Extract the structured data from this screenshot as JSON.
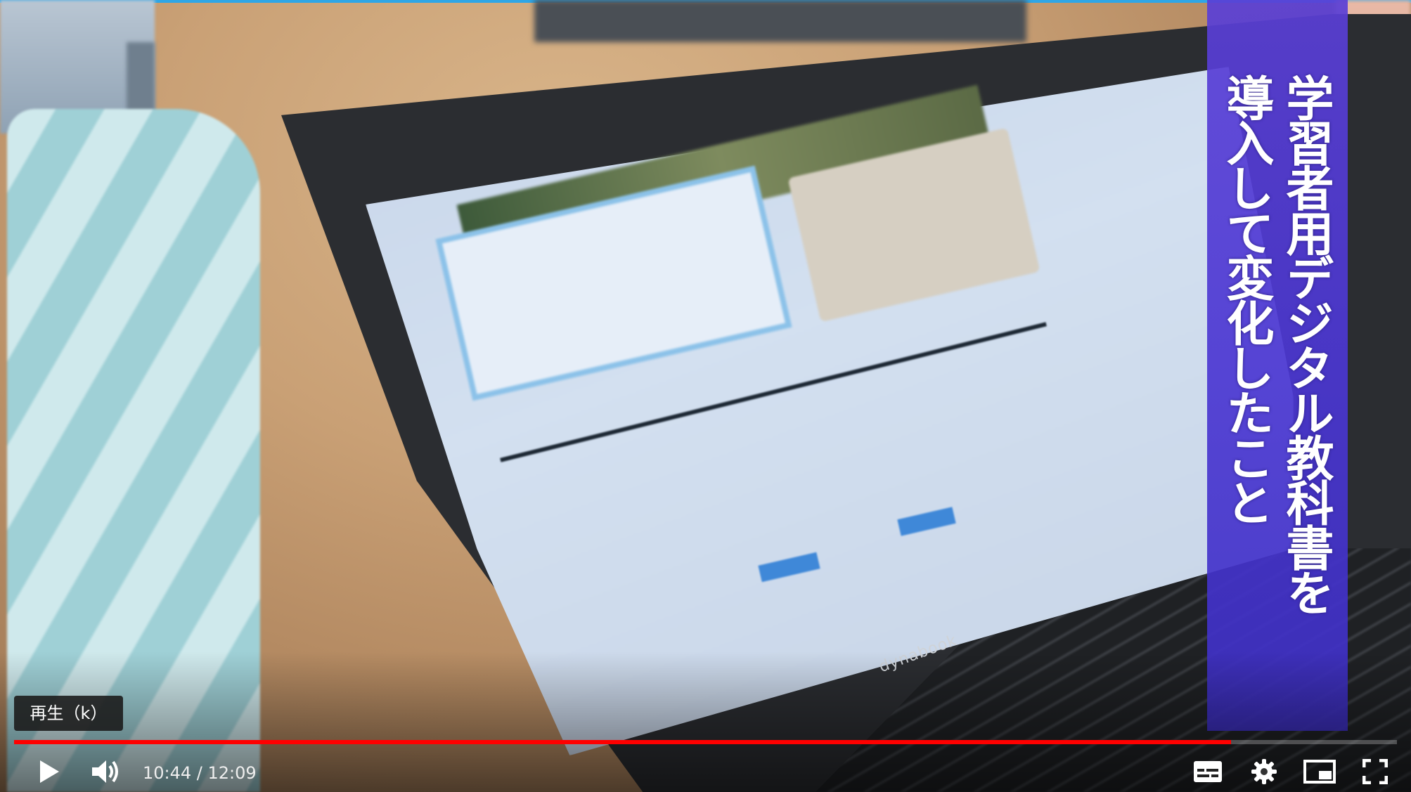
{
  "video": {
    "caption_lines": [
      "学習者用デジタル教科書を",
      "導入して変化したこと"
    ],
    "screen_brand": "dynabook"
  },
  "player": {
    "tooltip_label": "再生（k）",
    "current_time": "10:44",
    "duration": "12:09",
    "time_display": "10:44 / 12:09",
    "progress_fraction": 0.88,
    "icons": {
      "play": "play-icon",
      "volume": "volume-icon",
      "subtitles": "subtitles-icon",
      "settings": "gear-icon",
      "miniplayer": "miniplayer-icon",
      "fullscreen": "fullscreen-icon"
    },
    "colors": {
      "progress": "#ff0000",
      "caption_bg": "#4b37d2",
      "top_accent": "#2fa6e6"
    }
  }
}
